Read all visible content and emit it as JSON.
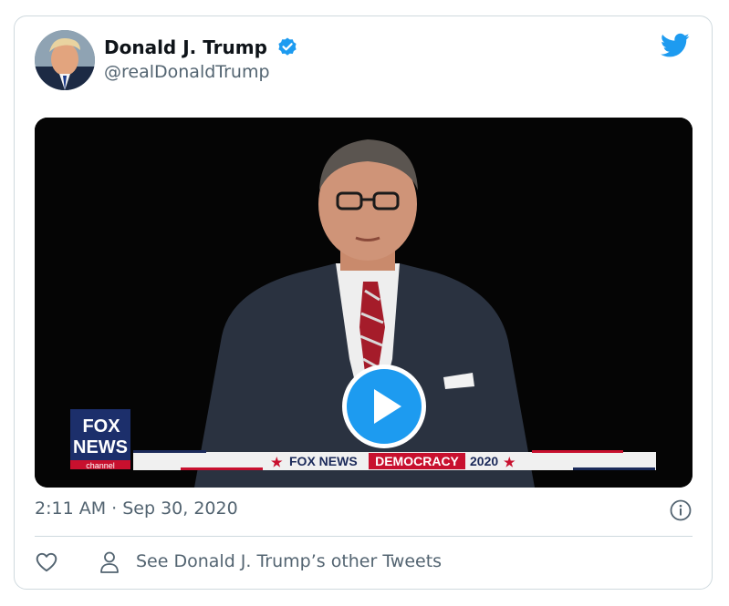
{
  "tweet": {
    "author_name": "Donald J. Trump",
    "handle": "@realDonaldTrump",
    "timestamp": "2:11 AM · Sep 30, 2020",
    "see_other": "See Donald J. Trump’s other Tweets"
  },
  "video": {
    "network_logo_line1": "FOX",
    "network_logo_line2": "NEWS",
    "network_logo_line3": "channel",
    "banner_network": "FOX NEWS",
    "banner_program": "DEMOCRACY",
    "banner_year": "2020"
  },
  "icons": {
    "verified": "verified-badge-icon",
    "bird": "twitter-bird-icon",
    "play": "play-icon",
    "info": "info-icon",
    "like": "heart-icon",
    "person": "person-icon"
  },
  "colors": {
    "twitter_blue": "#1d9bf0",
    "text_primary": "#0f1419",
    "text_secondary": "#536471",
    "border": "#cfd9de",
    "fox_red": "#c8102e",
    "fox_navy": "#1b2a5a"
  }
}
